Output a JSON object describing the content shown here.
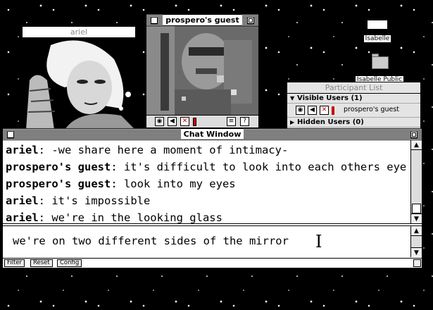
{
  "desktop": {
    "icons": [
      {
        "label": "Isabelle"
      },
      {
        "label": "Isabelle Public"
      }
    ]
  },
  "ariel_window": {
    "title": "ariel"
  },
  "guest_window": {
    "title": "prospero's guest"
  },
  "participant_list": {
    "title": "Participant List",
    "visible_header": "Visible Users (1)",
    "user": "prospero's guest",
    "hidden_header": "Hidden Users (0)"
  },
  "chat_window": {
    "title": "Chat Window",
    "messages": [
      {
        "speaker": "ariel",
        "text": ": -we share here a moment of intimacy-"
      },
      {
        "speaker": "prospero's guest",
        "text": ": it's difficult to look into each others eye"
      },
      {
        "speaker": "prospero's guest",
        "text": ": look into my eyes"
      },
      {
        "speaker": "ariel",
        "text": ": it's impossible"
      },
      {
        "speaker": "ariel",
        "text": ": we're in the looking glass"
      }
    ],
    "input_value": "we're on two different sides of the mirror",
    "buttons": {
      "filter": "Filter",
      "reset": "Reset",
      "config": "Config"
    }
  },
  "icons": {
    "camera": "camera-icon",
    "speaker": "speaker-icon",
    "mute": "mute-icon",
    "info": "info-icon",
    "help": "help-icon"
  },
  "colors": {
    "desktop": "#000000",
    "window": "#ffffff",
    "mute_red": "#cc0000"
  }
}
